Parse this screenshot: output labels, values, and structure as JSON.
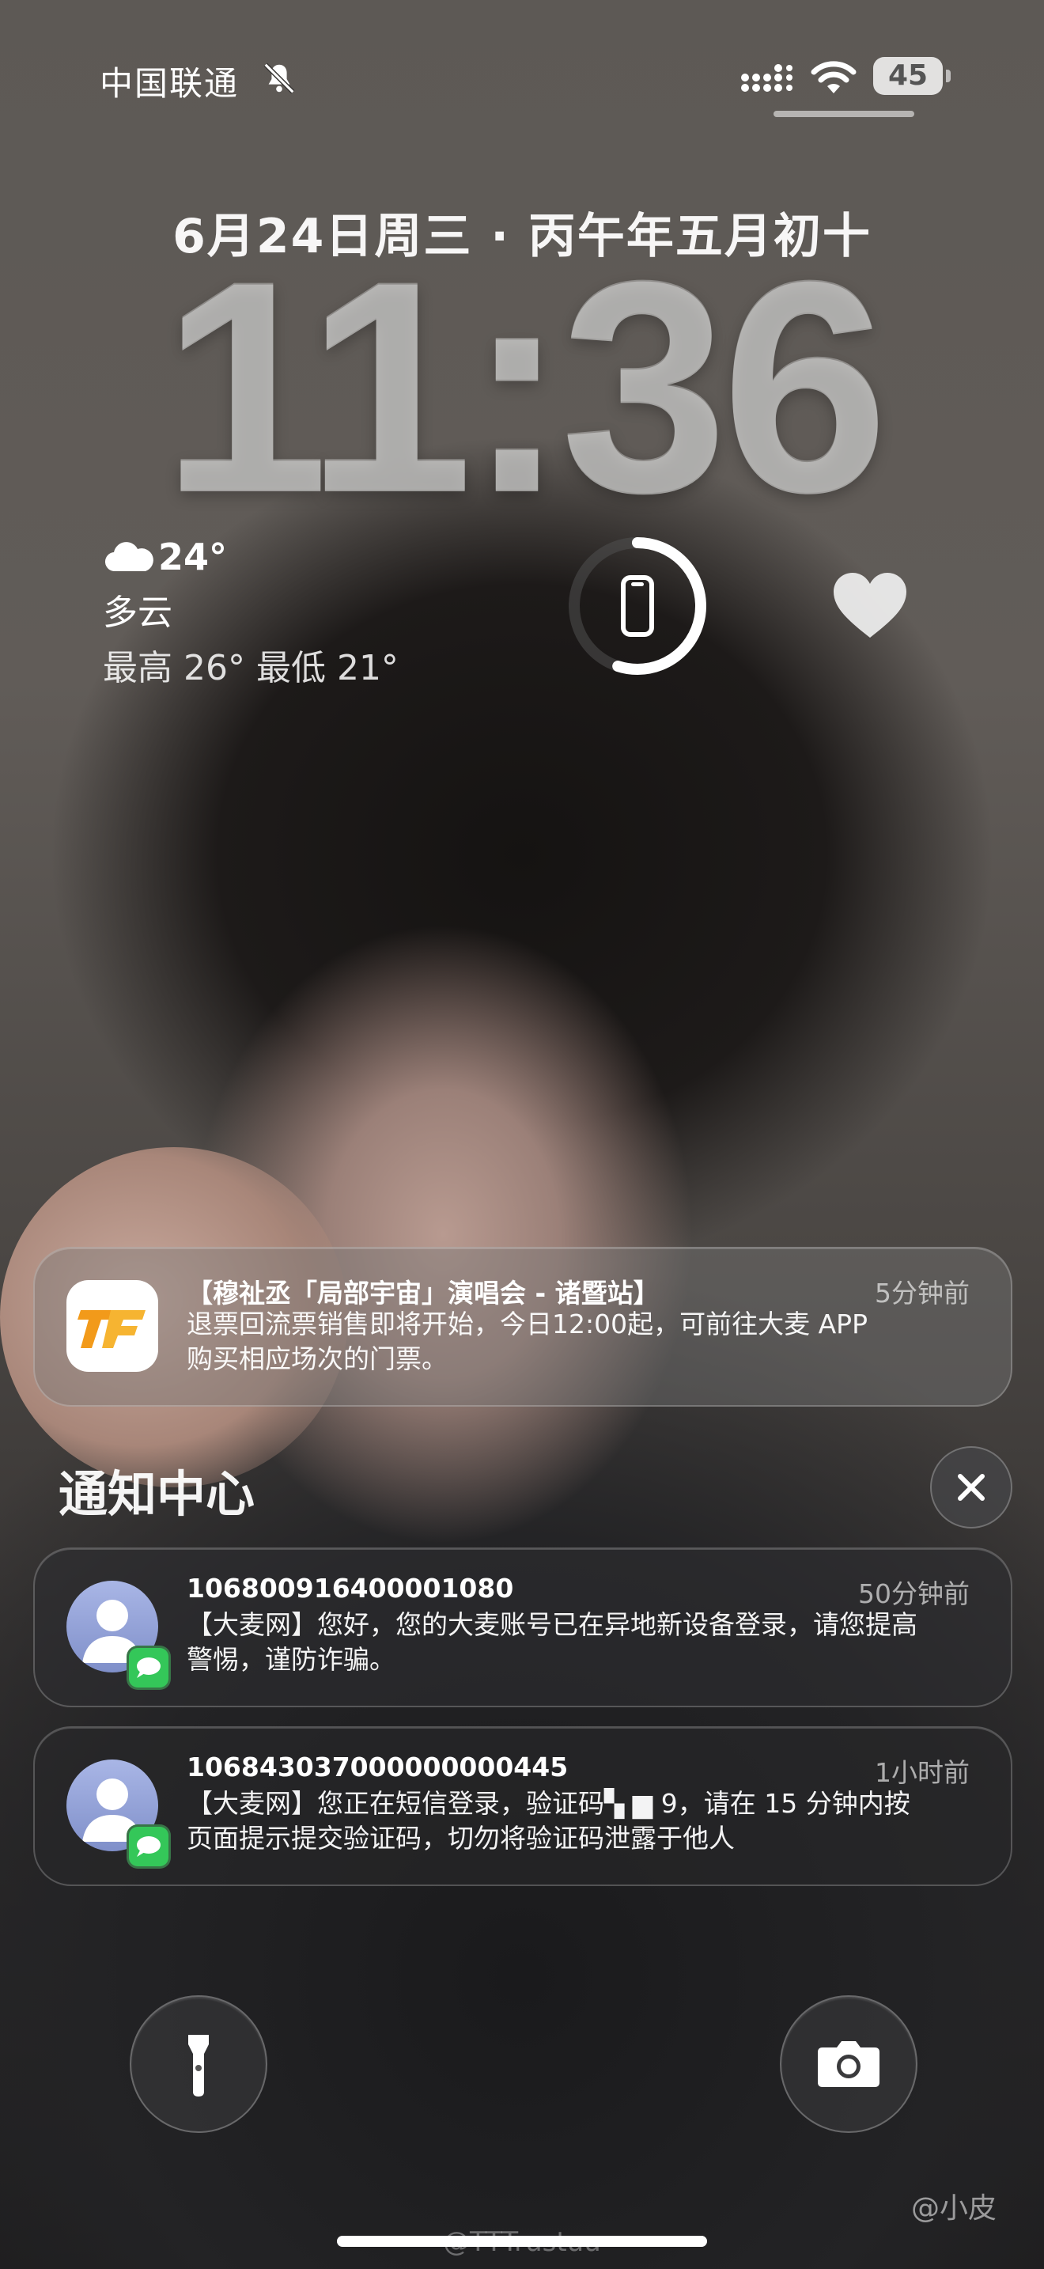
{
  "status_bar": {
    "carrier": "中国联通",
    "battery_level": "45"
  },
  "lock_screen": {
    "date": "6月24日周三 · 丙午年五月初十",
    "time": "11:36"
  },
  "weather": {
    "temp": "24°",
    "condition": "多云",
    "hi_lo": "最高 26° 最低 21°"
  },
  "widgets": {
    "battery_ring_fraction": 0.55
  },
  "notifications": [
    {
      "title": "【穆祉丞「局部宇宙」演唱会 - 诸暨站】",
      "time": "5分钟前",
      "body_line1": "退票回流票销售即将开始，今日12:00起，可前往大麦 APP",
      "body_line2": "购买相应场次的门票。",
      "icon": "tf-app-icon"
    }
  ],
  "notification_center": {
    "title": "通知中心",
    "items": [
      {
        "sender": "106800916400001080",
        "time": "50分钟前",
        "body_line1": "【大麦网】您好，您的大麦账号已在异地新设备登录，请您提高",
        "body_line2": "警惕，谨防诈骗。"
      },
      {
        "sender": "106843037000000000445",
        "time": "1小时前",
        "body_line1": "【大麦网】您正在短信登录，验证码▚ ▆ 9，请在 15 分钟内按",
        "body_line2": "页面提示提交验证码，切勿将验证码泄露于他人"
      }
    ]
  },
  "watermark": {
    "user": "@TTTrustuu",
    "name": "@小皮"
  },
  "colors": {
    "message_badge": "#34c759",
    "tf_orange": "#f29a1a"
  }
}
